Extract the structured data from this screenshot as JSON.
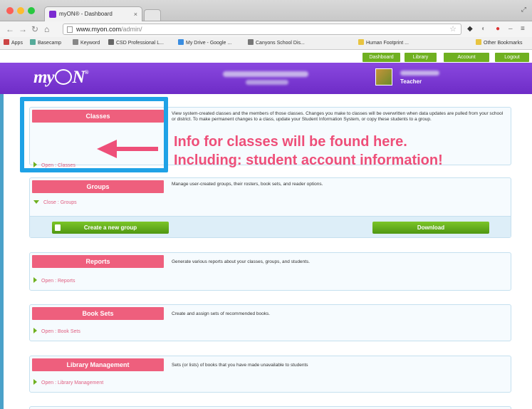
{
  "browser": {
    "tab_title": "myON® - Dashboard",
    "tab_close": "×",
    "url_host": "www.myon.com",
    "url_path": "/admin/",
    "bookmarks": [
      "Apps",
      "Basecamp",
      "Keyword",
      "CSD Professional L...",
      "My Drive - Google ...",
      "Canyons School Dis...",
      "Human Footprint ...",
      "Other Bookmarks"
    ]
  },
  "top_links": [
    "Dashboard",
    "Library",
    "Account",
    "Logout"
  ],
  "header": {
    "logo": "myON",
    "user_role": "Teacher"
  },
  "panels": [
    {
      "label": "Classes",
      "description": "View system-created classes and the members of those classes. Changes you make to classes will be overwritten when data updates are pulled from your school or district. To make permanent changes to a class, update your Student Information System, or copy these students to a group.",
      "link": "Open : Classes"
    },
    {
      "label": "Groups",
      "description": "Manage user-created groups, their rosters, book sets, and reader options.",
      "link": "Close : Groups",
      "create_button": "Create a new group",
      "download_button": "Download"
    },
    {
      "label": "Reports",
      "description": "Generate various reports about your classes, groups, and students.",
      "link": "Open : Reports"
    },
    {
      "label": "Book Sets",
      "description": "Create and assign sets of recommended books.",
      "link": "Open : Book Sets"
    },
    {
      "label": "Library Management",
      "description": "Sets (or lists) of books that you have made unavailable to students",
      "link": "Open : Library Management"
    }
  ],
  "annotation": {
    "line1": "Info for classes will be found here.",
    "line2": "Including: student account information!"
  },
  "colors": {
    "header_purple": "#7b3ad6",
    "panel_label_pink": "#ee5f7d",
    "button_green": "#6fb020",
    "highlight_blue": "#1fa2e6",
    "annotation_pink": "#ee4f79"
  }
}
